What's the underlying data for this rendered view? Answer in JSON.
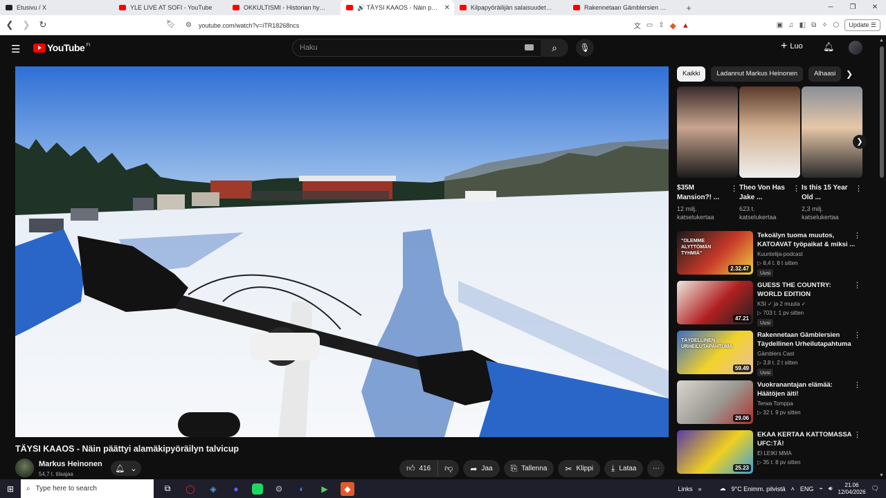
{
  "browser": {
    "tabs": [
      {
        "label": "Etusivu / X",
        "fav_color": "#222222",
        "active": false
      },
      {
        "label": "YLE LIVE AT SOFI - YouTube",
        "fav_color": "#ff0000",
        "active": false
      },
      {
        "label": "OKKULTISMI - Historian hyljätty totuus",
        "fav_color": "#ff0000",
        "active": false
      },
      {
        "label": "🔊 TÄYSI KAAOS - Näin päättyi alamäki",
        "fav_color": "#ff0000",
        "active": true
      },
      {
        "label": "Kilpapyöräilijän salaisuudet: Näin pi",
        "fav_color": "#ff0000",
        "active": false
      },
      {
        "label": "Rakennetaan Gämblersien Täydellinen",
        "fav_color": "#ff0000",
        "active": false
      }
    ],
    "url": "youtube.com/watch?v=iTR18268ncs",
    "update_label": "Update"
  },
  "youtube": {
    "search_placeholder": "Haku",
    "create_label": "Luo",
    "country_code": "FI"
  },
  "video": {
    "title": "TÄYSI KAAOS - Näin päättyi alamäkipyöräilyn talvicup",
    "channel": "Markus Heinonen",
    "subscribers": "54,7 t. tilaajaa",
    "likes": "416",
    "share_label": "Jaa",
    "save_label": "Tallenna",
    "clip_label": "Klippi",
    "download_label": "Lataa"
  },
  "sidebar": {
    "chips": [
      {
        "label": "Kaikki",
        "active": true
      },
      {
        "label": "Ladannut Markus Heinonen",
        "active": false
      },
      {
        "label": "Alhaasi",
        "active": false
      }
    ],
    "shorts": [
      {
        "title": "$35M Mansion?! ...",
        "views": "12 milj. katselukertaa",
        "thumb_colors": [
          "#3a2a2a",
          "#c9a58f",
          "#1b1b1b"
        ]
      },
      {
        "title": "Theo Von Has Jake ...",
        "views": "623 t. katselukertaa",
        "thumb_colors": [
          "#5b3a2a",
          "#d2b08f",
          "#eeeeee"
        ]
      },
      {
        "title": "Is this 15 Year Old ...",
        "views": "2,3 milj. katselukertaa",
        "thumb_colors": [
          "#8a8f98",
          "#e6c7a8",
          "#2a2a2a"
        ]
      }
    ],
    "recommendations": [
      {
        "title": "Tekoälyn tuoma muutos, KATOAVAT työpaikat & miksi ...",
        "channel": "Kuuntelija-podcast",
        "meta": "▷ 8,4 t.  8 t sitten",
        "badge": "Uusi",
        "duration": "2.32.47",
        "thumb_colors": [
          "#1a1a1a",
          "#c83a2a",
          "#f0d040"
        ],
        "thumb_text": "\"OLEMME ALYTTÖMÄN TYHMIÄ\""
      },
      {
        "title": "GUESS THE COUNTRY: WORLD EDITION",
        "channel": "KSI ✓ ja 2 muuta ✓",
        "meta": "▷ 703 t.  1 pv sitten",
        "badge": "Uusi",
        "duration": "47.21",
        "thumb_colors": [
          "#ece8e0",
          "#b02020",
          "#202020"
        ],
        "thumb_text": ""
      },
      {
        "title": "Rakennetaan Gämblersien Täydellinen Urheilutapahtuma",
        "channel": "Gämblers Cast",
        "meta": "▷ 3,8 t.  2 t sitten",
        "badge": "Uusi",
        "duration": "59.49",
        "thumb_colors": [
          "#3a6ec8",
          "#f2d22a",
          "#e8c0a0"
        ],
        "thumb_text": "TÄYDELLINEN URHEILUTAPAHTUMA"
      },
      {
        "title": "Vuokranantajan elämää: Häätöjen äiti!",
        "channel": "Terwa Tomppa",
        "meta": "▷ 32 t.  9 pv sitten",
        "badge": "",
        "duration": "29.06",
        "thumb_colors": [
          "#d8d6d0",
          "#9a9890",
          "#b03030"
        ],
        "thumb_text": ""
      },
      {
        "title": "EKAA KERTAA KATTOMASSA UFC:TÄ!",
        "channel": "El LEIKI MMA",
        "meta": "▷ 35 t.  8 pv sitten",
        "badge": "",
        "duration": "25.23",
        "thumb_colors": [
          "#5a3aa8",
          "#f0d020",
          "#3aa0d8"
        ],
        "thumb_text": ""
      }
    ]
  },
  "taskbar": {
    "search_placeholder": "Type here to search",
    "links_label": "Links",
    "weather": "9°C  Enimm. pilvistä",
    "language": "ENG",
    "time": "21.06",
    "date": "12/04/2026"
  }
}
